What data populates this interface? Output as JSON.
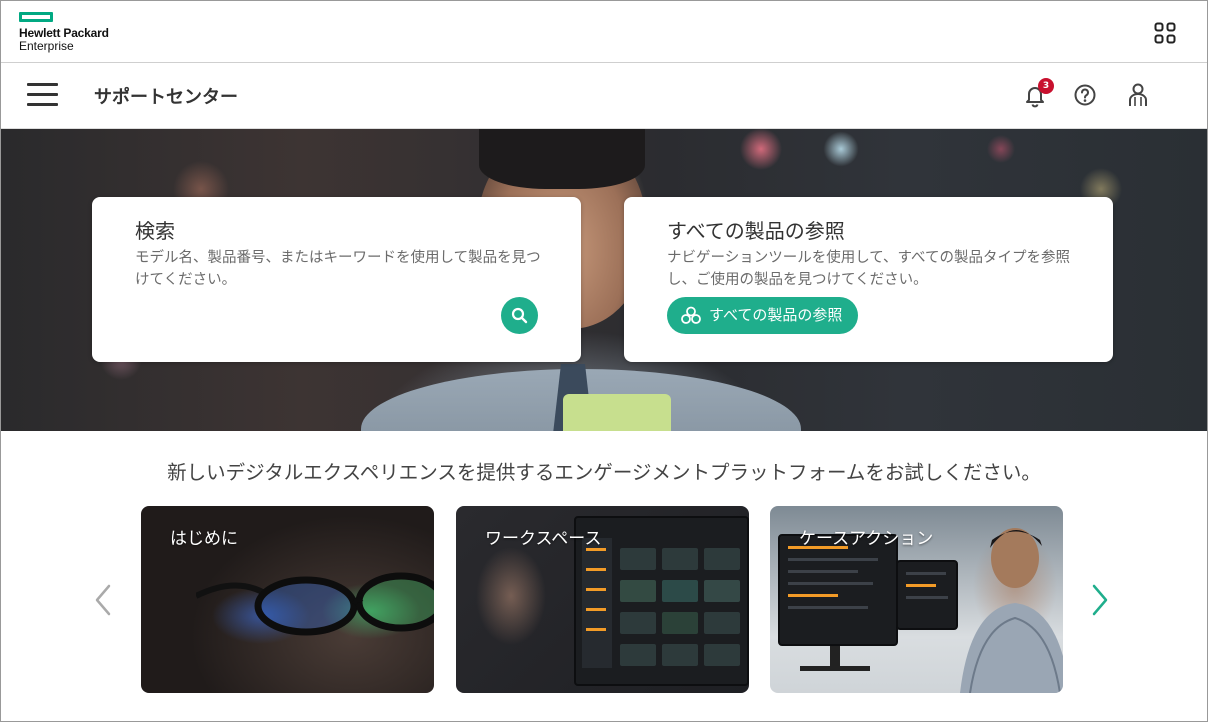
{
  "brand": {
    "line1": "Hewlett Packard",
    "line2": "Enterprise",
    "accent": "#01a982"
  },
  "header": {
    "apps_icon": "apps-grid-icon"
  },
  "nav": {
    "title": "サポートセンター",
    "notification_count": "3",
    "icons": [
      "hamburger-menu-icon",
      "bell-icon",
      "help-icon",
      "user-icon"
    ]
  },
  "search_card": {
    "title": "検索",
    "description": "モデル名、製品番号、またはキーワードを使用して製品を見つけてください。",
    "input_value": "",
    "input_placeholder": ""
  },
  "browse_card": {
    "title": "すべての製品の参照",
    "description": "ナビゲーションツールを使用して、すべての製品タイプを参照し、ご使用の製品を見つけてください。",
    "button_label": "すべての製品の参照"
  },
  "promo": {
    "text": "新しいデジタルエクスペリエンスを提供するエンゲージメントプラットフォームをお試しください。"
  },
  "carousel": {
    "tiles": [
      {
        "label": "はじめに"
      },
      {
        "label": "ワークスペース"
      },
      {
        "label": "ケースアクション"
      }
    ]
  },
  "colors": {
    "primary_green": "#1fae8c",
    "badge_red": "#c8102e",
    "arrow_right": "#1fae8c",
    "arrow_left": "#aaaaaa"
  }
}
